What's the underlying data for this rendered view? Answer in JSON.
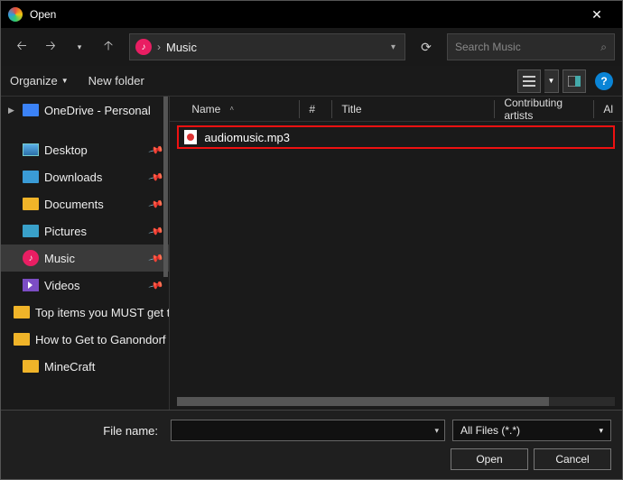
{
  "window": {
    "title": "Open"
  },
  "nav": {
    "location_icon": "music",
    "breadcrumb_sep": "›",
    "breadcrumb": "Music"
  },
  "search": {
    "placeholder": "Search Music"
  },
  "toolbar": {
    "organize": "Organize",
    "new_folder": "New folder"
  },
  "sidebar": {
    "onedrive": "OneDrive - Personal",
    "items": [
      {
        "label": "Desktop",
        "kind": "monitor",
        "pinned": true
      },
      {
        "label": "Downloads",
        "kind": "folder",
        "pinned": true
      },
      {
        "label": "Documents",
        "kind": "folder",
        "pinned": true
      },
      {
        "label": "Pictures",
        "kind": "folder",
        "pinned": true
      },
      {
        "label": "Music",
        "kind": "music",
        "pinned": true,
        "selected": true
      },
      {
        "label": "Videos",
        "kind": "video",
        "pinned": true
      },
      {
        "label": "Top items you MUST get t",
        "kind": "folder",
        "pinned": false
      },
      {
        "label": "How to Get to Ganondorf",
        "kind": "folder",
        "pinned": false
      },
      {
        "label": "MineCraft",
        "kind": "folder",
        "pinned": false
      }
    ]
  },
  "columns": {
    "name": "Name",
    "num": "#",
    "title": "Title",
    "artists": "Contributing artists",
    "album": "Al"
  },
  "files": [
    {
      "name": "audiomusic.mp3",
      "highlighted": true
    }
  ],
  "footer": {
    "filename_label": "File name:",
    "filename_value": "",
    "filetype": "All Files (*.*)",
    "open": "Open",
    "cancel": "Cancel"
  }
}
